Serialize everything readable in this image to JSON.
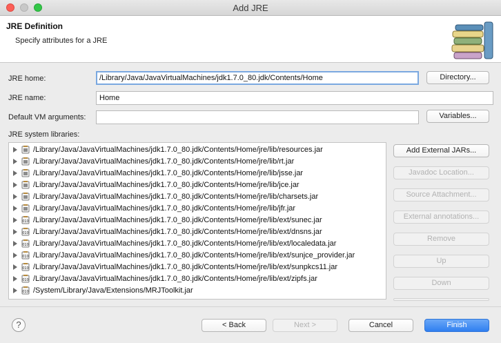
{
  "window": {
    "title": "Add JRE"
  },
  "header": {
    "title": "JRE Definition",
    "subtitle": "Specify attributes for a JRE",
    "icon": "library-books-icon"
  },
  "form": {
    "jre_home_label": "JRE home:",
    "jre_home_value": "/Library/Java/JavaVirtualMachines/jdk1.7.0_80.jdk/Contents/Home",
    "directory_button": "Directory...",
    "jre_name_label": "JRE name:",
    "jre_name_value": "Home",
    "vm_args_label": "Default VM arguments:",
    "vm_args_value": "",
    "variables_button": "Variables...",
    "libraries_label": "JRE system libraries:"
  },
  "libraries": [
    {
      "path": "/Library/Java/JavaVirtualMachines/jdk1.7.0_80.jdk/Contents/Home/jre/lib/resources.jar",
      "icon": "jar-icon"
    },
    {
      "path": "/Library/Java/JavaVirtualMachines/jdk1.7.0_80.jdk/Contents/Home/jre/lib/rt.jar",
      "icon": "jar-icon"
    },
    {
      "path": "/Library/Java/JavaVirtualMachines/jdk1.7.0_80.jdk/Contents/Home/jre/lib/jsse.jar",
      "icon": "jar-icon"
    },
    {
      "path": "/Library/Java/JavaVirtualMachines/jdk1.7.0_80.jdk/Contents/Home/jre/lib/jce.jar",
      "icon": "jar-icon"
    },
    {
      "path": "/Library/Java/JavaVirtualMachines/jdk1.7.0_80.jdk/Contents/Home/jre/lib/charsets.jar",
      "icon": "jar-icon"
    },
    {
      "path": "/Library/Java/JavaVirtualMachines/jdk1.7.0_80.jdk/Contents/Home/jre/lib/jfr.jar",
      "icon": "jar-icon"
    },
    {
      "path": "/Library/Java/JavaVirtualMachines/jdk1.7.0_80.jdk/Contents/Home/jre/lib/ext/sunec.jar",
      "icon": "binary-jar-icon"
    },
    {
      "path": "/Library/Java/JavaVirtualMachines/jdk1.7.0_80.jdk/Contents/Home/jre/lib/ext/dnsns.jar",
      "icon": "binary-jar-icon"
    },
    {
      "path": "/Library/Java/JavaVirtualMachines/jdk1.7.0_80.jdk/Contents/Home/jre/lib/ext/localedata.jar",
      "icon": "binary-jar-icon"
    },
    {
      "path": "/Library/Java/JavaVirtualMachines/jdk1.7.0_80.jdk/Contents/Home/jre/lib/ext/sunjce_provider.jar",
      "icon": "binary-jar-icon"
    },
    {
      "path": "/Library/Java/JavaVirtualMachines/jdk1.7.0_80.jdk/Contents/Home/jre/lib/ext/sunpkcs11.jar",
      "icon": "binary-jar-icon"
    },
    {
      "path": "/Library/Java/JavaVirtualMachines/jdk1.7.0_80.jdk/Contents/Home/jre/lib/ext/zipfs.jar",
      "icon": "binary-jar-icon"
    },
    {
      "path": "/System/Library/Java/Extensions/MRJToolkit.jar",
      "icon": "binary-jar-icon"
    }
  ],
  "side_buttons": {
    "add_external": "Add External JARs...",
    "javadoc": "Javadoc Location...",
    "source": "Source Attachment...",
    "annotations": "External annotations...",
    "remove": "Remove",
    "up": "Up",
    "down": "Down"
  },
  "footer": {
    "help": "?",
    "back": "< Back",
    "next": "Next >",
    "cancel": "Cancel",
    "finish": "Finish"
  },
  "colors": {
    "primary": "#2f7ff0",
    "close": "#fc5f57",
    "maximize": "#33c748"
  }
}
